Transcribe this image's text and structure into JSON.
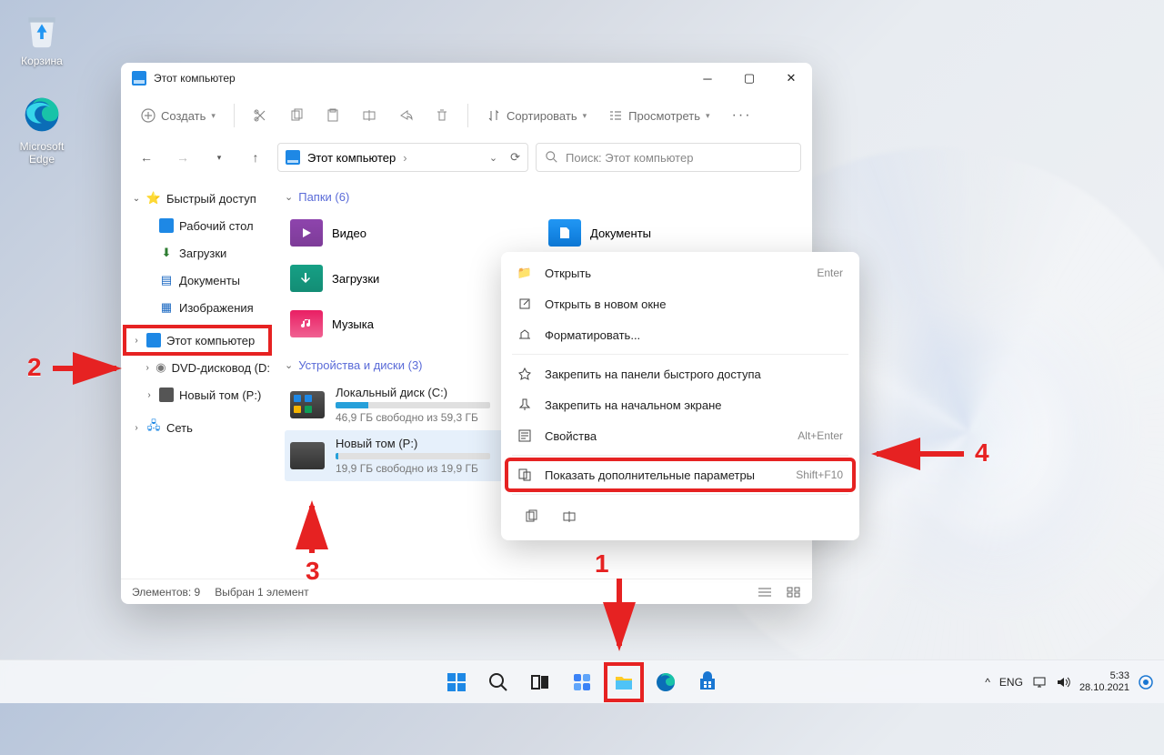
{
  "desktop": {
    "recycle_label": "Корзина",
    "edge_label": "Microsoft Edge"
  },
  "window": {
    "title": "Этот компьютер",
    "toolbar": {
      "new_label": "Создать",
      "sort_label": "Сортировать",
      "view_label": "Просмотреть"
    },
    "address": {
      "path": "Этот компьютер"
    },
    "search": {
      "placeholder": "Поиск: Этот компьютер"
    },
    "nav": {
      "quick_access": "Быстрый доступ",
      "desktop": "Рабочий стол",
      "downloads": "Загрузки",
      "documents": "Документы",
      "pictures": "Изображения",
      "this_pc": "Этот компьютер",
      "dvd": "DVD-дисковод (D:",
      "new_vol": "Новый том (P:)",
      "network": "Сеть"
    },
    "content": {
      "folders_header": "Папки (6)",
      "devices_header": "Устройства и диски (3)",
      "folder_video": "Видео",
      "folder_documents": "Документы",
      "folder_downloads": "Загрузки",
      "folder_music": "Музыка",
      "drive_c_name": "Локальный диск (C:)",
      "drive_c_free": "46,9 ГБ свободно из 59,3 ГБ",
      "drive_c_fill_pct": 21,
      "drive_p_name": "Новый том (P:)",
      "drive_p_free": "19,9 ГБ свободно из 19,9 ГБ",
      "drive_p_fill_pct": 2
    },
    "status": {
      "elements": "Элементов: 9",
      "selected": "Выбран 1 элемент"
    }
  },
  "context_menu": {
    "open": "Открыть",
    "open_shortcut": "Enter",
    "open_new": "Открыть в новом окне",
    "format": "Форматировать...",
    "pin_quick": "Закрепить на панели быстрого доступа",
    "pin_start": "Закрепить на начальном экране",
    "properties": "Свойства",
    "properties_shortcut": "Alt+Enter",
    "more": "Показать дополнительные параметры",
    "more_shortcut": "Shift+F10"
  },
  "taskbar": {
    "lang": "ENG",
    "time": "5:33",
    "date": "28.10.2021"
  },
  "annotations": {
    "n1": "1",
    "n2": "2",
    "n3": "3",
    "n4": "4"
  }
}
